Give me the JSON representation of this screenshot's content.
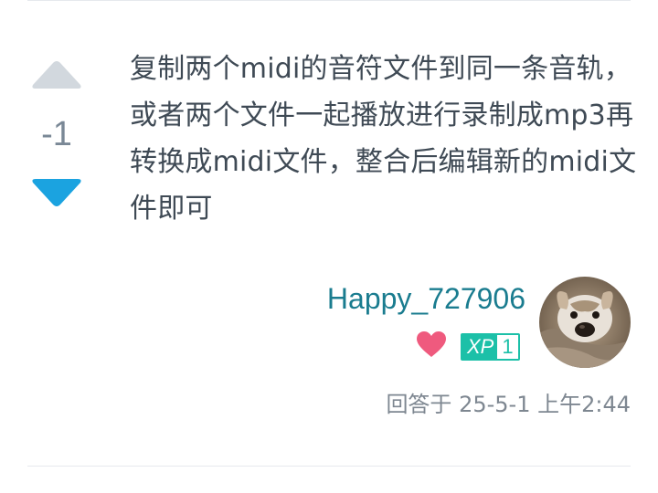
{
  "vote": {
    "score": "-1",
    "upvote_icon": "triangle-up-icon",
    "downvote_icon": "triangle-down-icon",
    "upvote_color": "#d2d8de",
    "downvote_color": "#1ba3e0"
  },
  "answer": {
    "text": "复制两个midi的音符文件到同一条音轨，或者两个文件一起播放进行录制成mp3再转换成midi文件，整合后编辑新的midi文件即可"
  },
  "author": {
    "username": "Happy_727906",
    "heart_icon": "heart-icon",
    "heart_color": "#ef5a7e",
    "xp_label": "XP",
    "xp_level": "1",
    "xp_color": "#1cc0a8",
    "avatar": "dog-avatar"
  },
  "meta": {
    "timestamp": "回答于 25-5-1 上午2:44"
  }
}
